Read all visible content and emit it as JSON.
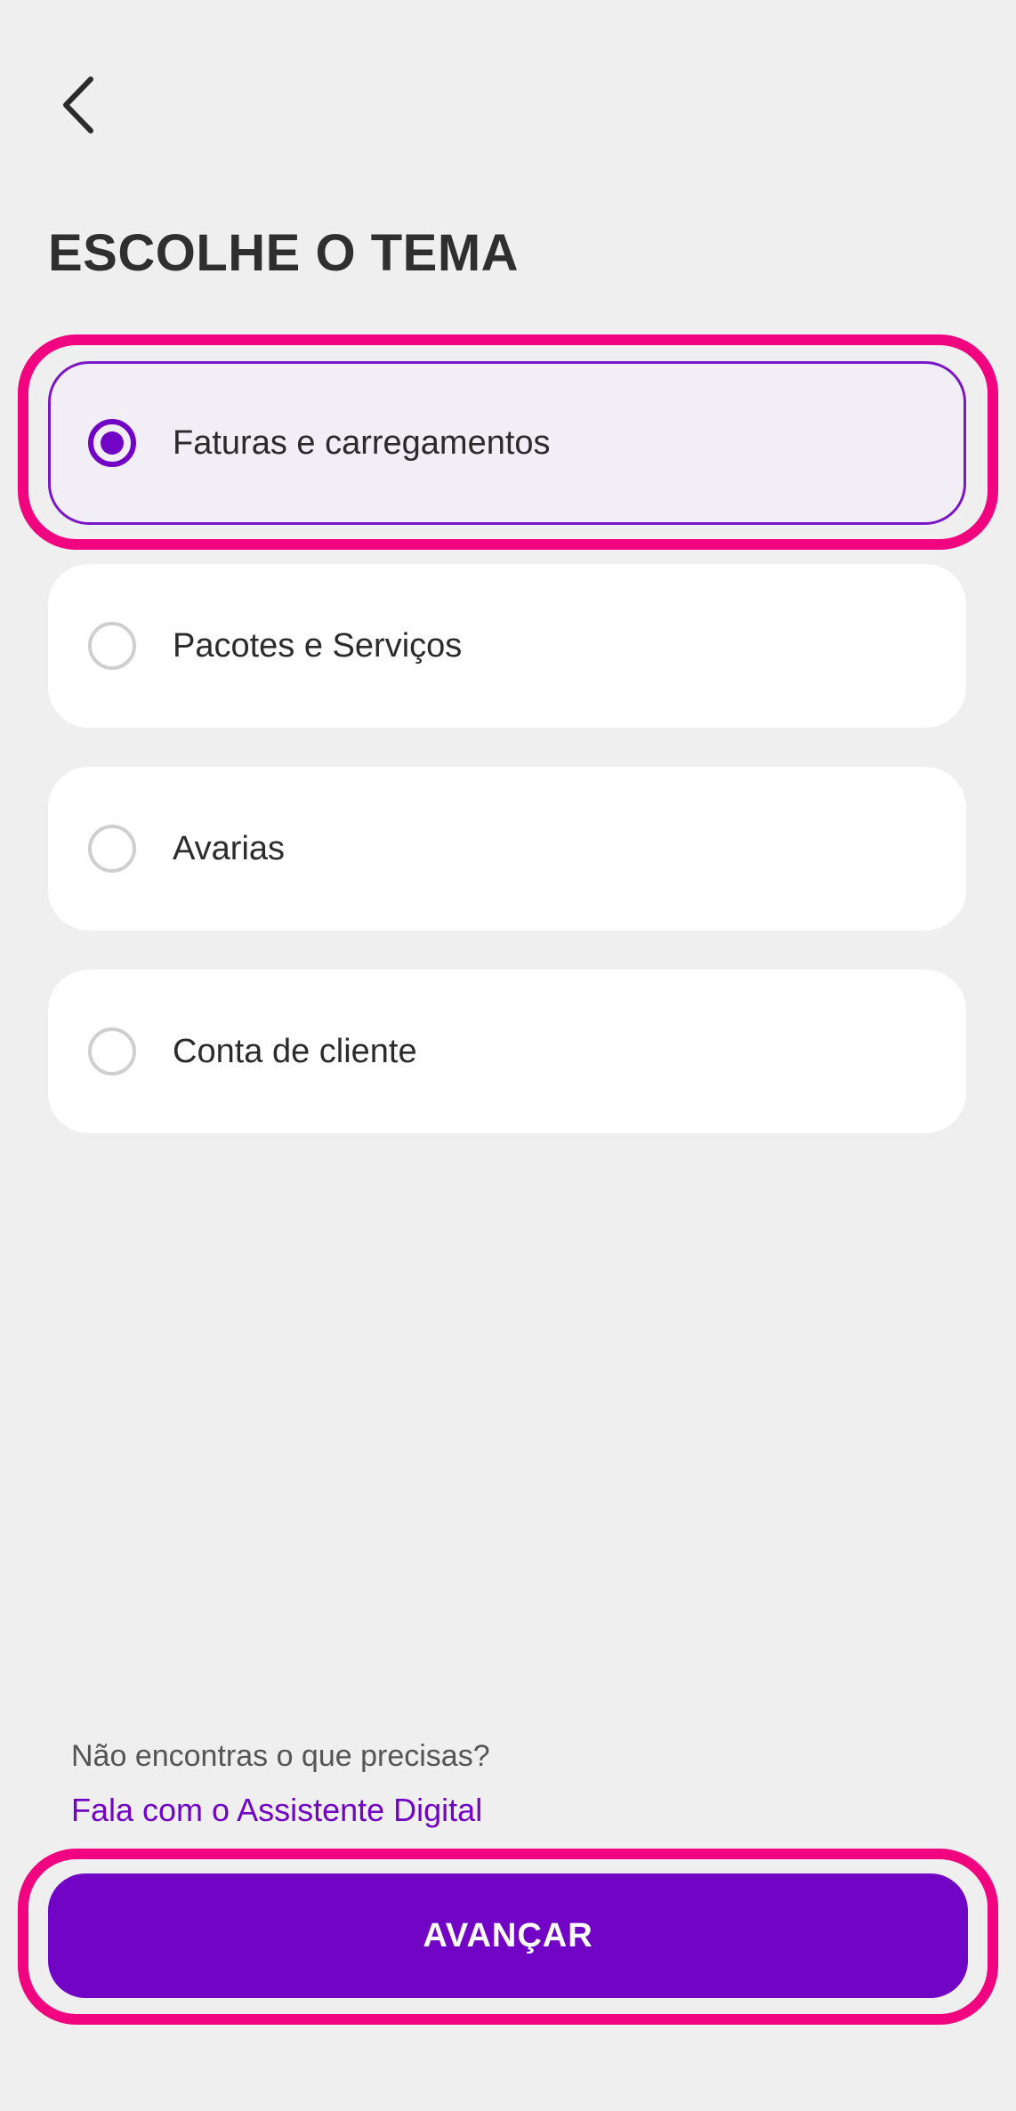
{
  "header": {
    "back_icon": "chevron-left-icon",
    "title": "ESCOLHE O TEMA"
  },
  "topics": {
    "selected_index": 0,
    "options": [
      {
        "label": "Faturas e carregamentos",
        "selected": true
      },
      {
        "label": "Pacotes e Serviços",
        "selected": false
      },
      {
        "label": "Avarias",
        "selected": false
      },
      {
        "label": "Conta de cliente",
        "selected": false
      }
    ]
  },
  "help": {
    "question": "Não encontras o que precisas?",
    "link": "Fala com o Assistente Digital"
  },
  "footer": {
    "next_label": "AVANÇAR"
  },
  "colors": {
    "brand_purple": "#7204c6",
    "highlight_pink": "#f0047f",
    "background": "#efefef",
    "selected_option_bg": "#f2eef6"
  }
}
